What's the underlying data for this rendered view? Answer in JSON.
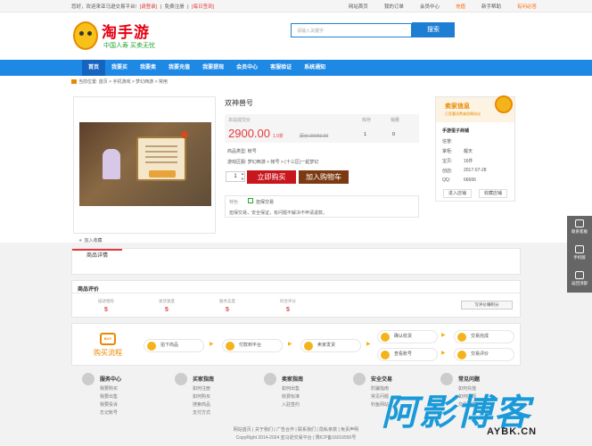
{
  "topbar": {
    "welcome": "您好，欢迎来亚马逊交易平台!",
    "login": "[请登录]",
    "sep1": "|",
    "register": "免费注册",
    "sep2": "|",
    "daily": "[每日签到]",
    "links": [
      "网站首页",
      "我的订单",
      "会员中心",
      "充值",
      "新手帮助",
      "有问必答"
    ]
  },
  "header": {
    "logo_title": "淘手游",
    "logo_sub": "中国人寿 买卖无忧",
    "search_placeholder": "请输入关键字",
    "search_button": "搜索"
  },
  "nav": {
    "items": [
      "首页",
      "我要买",
      "我要卖",
      "我要充值",
      "我要提现",
      "会员中心",
      "客服验证",
      "系统通知"
    ]
  },
  "breadcrumb": "当前位置: 首页 > 手机游戏 > 梦幻西游 > 常用",
  "product": {
    "title": "双神兽号",
    "price_label": "本站成交价",
    "price": "2900.00",
    "discount": "1.0折",
    "orig_label": "原价:",
    "orig_price": "29060.00",
    "stock_label": "库存",
    "stock": "1",
    "sold_label": "销量",
    "sold": "0",
    "type_label": "商品类型:",
    "type": "帐号",
    "region_label": "游戏区服:",
    "region": "梦幻西游 > 帐号 > (十三区)一起梦幻",
    "qty": "1",
    "buy_button": "立即购买",
    "cart_button": "加入购物车",
    "feature_label": "特色",
    "feature": "担保交易",
    "desc": "担保交易，安全保证，有问题不解决不申请退款。",
    "fav": "加入收藏"
  },
  "seller": {
    "header_title": "卖家信息",
    "header_sub": "已签署消费者保障协议",
    "shop_name": "手游蛋子商铺",
    "rows": [
      {
        "label": "信誉:",
        "value": ""
      },
      {
        "label": "掌柜:",
        "value": "靓天"
      },
      {
        "label": "宝贝:",
        "value": "16件"
      },
      {
        "label": "创店:",
        "value": "2017-07-28"
      },
      {
        "label": "QQ:",
        "value": "66666"
      }
    ],
    "enter_shop": "进入店铺",
    "fav_shop": "收藏店铺"
  },
  "details": {
    "tab": "商品详情"
  },
  "reviews": {
    "title": "商品评价",
    "items": [
      {
        "label": "描述相符",
        "value": "5"
      },
      {
        "label": "发货速度",
        "value": "5"
      },
      {
        "label": "服务态度",
        "value": "5"
      },
      {
        "label": "综合评分",
        "value": "5"
      }
    ],
    "write": "写评价赚积分"
  },
  "process": {
    "icon": "BUY",
    "label": "购买流程",
    "steps": [
      "拍下商品",
      "付款到平台",
      "卖家发货",
      "确认收货",
      "交易完成",
      "查看账号",
      "交易评价"
    ]
  },
  "footer": {
    "cols": [
      {
        "title": "服务中心",
        "links": [
          "我要购买",
          "我要出售",
          "我要投诉",
          "忘记账号"
        ]
      },
      {
        "title": "买家指南",
        "links": [
          "如何注册",
          "如何购买",
          "搜索商品",
          "支付方式"
        ]
      },
      {
        "title": "卖家指南",
        "links": [
          "如何出售",
          "收费标准",
          "入驻签约"
        ]
      },
      {
        "title": "安全交易",
        "links": [
          "防骗指南",
          "常见问题",
          "钓鱼网站"
        ]
      },
      {
        "title": "常见问题",
        "links": [
          "如何充值",
          "如何提现",
          "交易保障"
        ]
      }
    ],
    "links_line": "网站首页 | 关于我们 | 广告合作 | 联系我们 | 隐私条款 | 免责声明",
    "copyright": "CopyRight 2014-2024 亚马逊交易平台 | 豫ICP备16016550号"
  },
  "sidebar": {
    "items": [
      "联系客服",
      "手机版",
      "返回顶部"
    ]
  },
  "watermark": {
    "text": "阿影博客",
    "url": "AYBK.CN"
  }
}
